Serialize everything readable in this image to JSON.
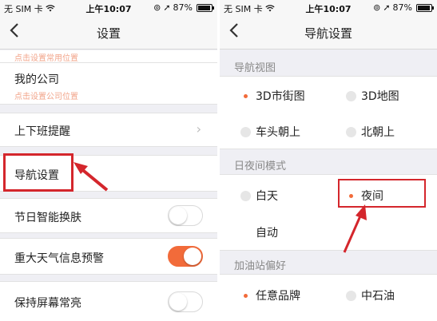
{
  "left": {
    "status": {
      "carrier": "无 SIM 卡",
      "time": "上午10:07",
      "battery": "87%"
    },
    "nav": {
      "title": "设置"
    },
    "top_hint": "点击设置常用位置",
    "company": {
      "label": "我的公司",
      "hint": "点击设置公司位置"
    },
    "commute": {
      "label": "上下班提醒"
    },
    "navigation": {
      "label": "导航设置"
    },
    "festival": {
      "label": "节日智能换肤",
      "on": false
    },
    "weather": {
      "label": "重大天气信息预警",
      "on": true
    },
    "screen_on": {
      "label": "保持屏幕常亮",
      "on": false
    }
  },
  "right": {
    "status": {
      "carrier": "无 SIM 卡",
      "time": "上午10:07",
      "battery": "87%"
    },
    "nav": {
      "title": "导航设置"
    },
    "view_section": {
      "label": "导航视图",
      "options": [
        "3D市街图",
        "3D地图",
        "车头朝上",
        "北朝上"
      ],
      "selected": "3D市街图"
    },
    "daynight_section": {
      "label": "日夜间模式",
      "options": [
        "白天",
        "夜间",
        "自动"
      ],
      "selected": "夜间"
    },
    "gas_section": {
      "label": "加油站偏好",
      "options": [
        "任意品牌",
        "中石油"
      ],
      "selected": "任意品牌"
    }
  },
  "colors": {
    "accent": "#f26b3a",
    "annotation_red": "#d4262c"
  },
  "icons": {
    "back": "chevron-left-icon",
    "forward": "chevron-right-icon",
    "location": "location-arrow-icon",
    "wifi": "wifi-icon",
    "battery": "battery-icon"
  }
}
